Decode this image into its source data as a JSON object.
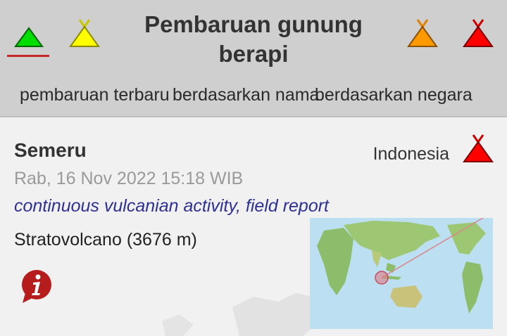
{
  "header": {
    "title": "Pembaruan gunung berapi",
    "level_icons": [
      "alert-level-green-icon",
      "alert-level-yellow-icon",
      "alert-level-orange-icon",
      "alert-level-red-icon"
    ],
    "sort_options": [
      "pembaruan terbaru",
      "berdasarkan nama",
      "berdasarkan negara"
    ],
    "active_sort": "pembaruan terbaru"
  },
  "colors": {
    "header_bg": "#cfcfcf",
    "green": "#00dd00",
    "yellow": "#ffff00",
    "orange": "#ff9900",
    "red": "#ff0000",
    "accent_underline": "#c62828",
    "activity_text": "#2e3192",
    "info_icon": "#b71c1c"
  },
  "volcano": {
    "name": "Semeru",
    "country": "Indonesia",
    "date": "Rab, 16 Nov 2022 15:18 WIB",
    "activity": "continuous vulcanian activity, field report",
    "type": "Stratovolcano (3676 m)",
    "alert_icon": "alert-level-red-icon",
    "info_icon": "info-icon"
  }
}
